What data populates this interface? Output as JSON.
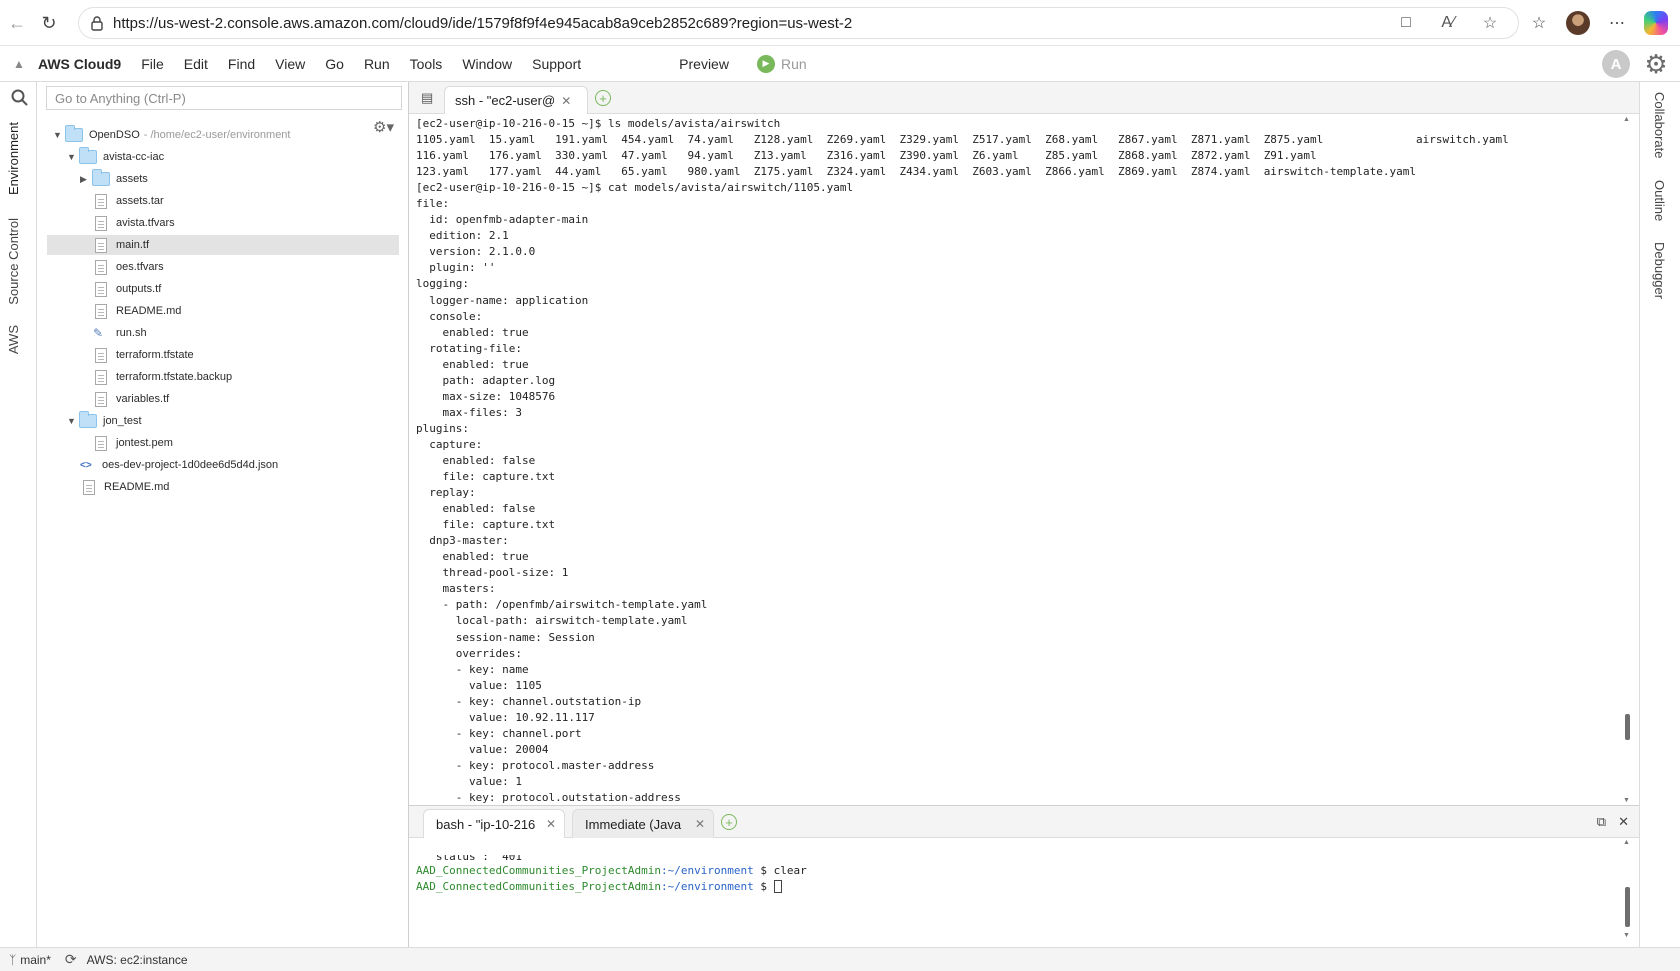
{
  "browser": {
    "url": "https://us-west-2.console.aws.amazon.com/cloud9/ide/1579f8f9f4e945acab8a9ceb2852c689?region=us-west-2"
  },
  "menubar": {
    "brand": "AWS Cloud9",
    "items": [
      "File",
      "Edit",
      "Find",
      "View",
      "Go",
      "Run",
      "Tools",
      "Window",
      "Support"
    ],
    "preview": "Preview",
    "run": "Run",
    "avatar_letter": "A"
  },
  "left_tabs": [
    "Environment",
    "Source Control",
    "AWS"
  ],
  "right_tabs": [
    "Collaborate",
    "Outline",
    "Debugger"
  ],
  "search": {
    "placeholder": "Go to Anything (Ctrl-P)"
  },
  "tree": {
    "root": {
      "name": "OpenDSO",
      "path": "- /home/ec2-user/environment"
    },
    "items": [
      {
        "name": "avista-cc-iac",
        "type": "folder",
        "open": true,
        "level": 1
      },
      {
        "name": "assets",
        "type": "folder",
        "open": false,
        "level": 2
      },
      {
        "name": "assets.tar",
        "type": "file",
        "level": 2
      },
      {
        "name": "avista.tfvars",
        "type": "file",
        "level": 2
      },
      {
        "name": "main.tf",
        "type": "file",
        "level": 2,
        "selected": true
      },
      {
        "name": "oes.tfvars",
        "type": "file",
        "level": 2
      },
      {
        "name": "outputs.tf",
        "type": "file",
        "level": 2
      },
      {
        "name": "README.md",
        "type": "file",
        "level": 2
      },
      {
        "name": "run.sh",
        "type": "file",
        "level": 2
      },
      {
        "name": "terraform.tfstate",
        "type": "file",
        "level": 2
      },
      {
        "name": "terraform.tfstate.backup",
        "type": "file",
        "level": 2
      },
      {
        "name": "variables.tf",
        "type": "file",
        "level": 2
      },
      {
        "name": "jon_test",
        "type": "folder",
        "open": true,
        "level": 1
      },
      {
        "name": "jontest.pem",
        "type": "file",
        "level": 2
      },
      {
        "name": "oes-dev-project-1d0dee6d5d4d.json",
        "type": "file",
        "level": 1
      },
      {
        "name": "README.md",
        "type": "file",
        "level": 1
      }
    ]
  },
  "editor_tab": {
    "label": "ssh - \"ec2-user@"
  },
  "terminal_lines": [
    "[ec2-user@ip-10-216-0-15 ~]$ ls models/avista/airswitch",
    "1105.yaml  15.yaml   191.yaml  454.yaml  74.yaml   Z128.yaml  Z269.yaml  Z329.yaml  Z517.yaml  Z68.yaml   Z867.yaml  Z871.yaml  Z875.yaml              airswitch.yaml",
    "116.yaml   176.yaml  330.yaml  47.yaml   94.yaml   Z13.yaml   Z316.yaml  Z390.yaml  Z6.yaml    Z85.yaml   Z868.yaml  Z872.yaml  Z91.yaml",
    "123.yaml   177.yaml  44.yaml   65.yaml   980.yaml  Z175.yaml  Z324.yaml  Z434.yaml  Z603.yaml  Z866.yaml  Z869.yaml  Z874.yaml  airswitch-template.yaml",
    "[ec2-user@ip-10-216-0-15 ~]$ cat models/avista/airswitch/1105.yaml",
    "file:",
    "  id: openfmb-adapter-main",
    "  edition: 2.1",
    "  version: 2.1.0.0",
    "  plugin: ''",
    "logging:",
    "  logger-name: application",
    "  console:",
    "    enabled: true",
    "  rotating-file:",
    "    enabled: true",
    "    path: adapter.log",
    "    max-size: 1048576",
    "    max-files: 3",
    "plugins:",
    "  capture:",
    "    enabled: false",
    "    file: capture.txt",
    "  replay:",
    "    enabled: false",
    "    file: capture.txt",
    "  dnp3-master:",
    "    enabled: true",
    "    thread-pool-size: 1",
    "    masters:",
    "    - path: /openfmb/airswitch-template.yaml",
    "      local-path: airswitch-template.yaml",
    "      session-name: Session",
    "      overrides:",
    "      - key: name",
    "        value: 1105",
    "      - key: channel.outstation-ip",
    "        value: 10.92.11.117",
    "      - key: channel.port",
    "        value: 20004",
    "      - key: protocol.master-address",
    "        value: 1",
    "      - key: protocol.outstation-address"
  ],
  "console": {
    "tabs": [
      {
        "label": "bash - \"ip-10-216"
      },
      {
        "label": "Immediate (Java"
      }
    ],
    "partial_line": "  \"status\": \"401\"",
    "prompt_user": "AAD_ConnectedCommunities_ProjectAdmin",
    "prompt_path": ":~/environment",
    "prompt_symbol": " $ ",
    "command1": "clear"
  },
  "status": {
    "branch": "main*",
    "aws": "AWS: ec2:instance"
  }
}
